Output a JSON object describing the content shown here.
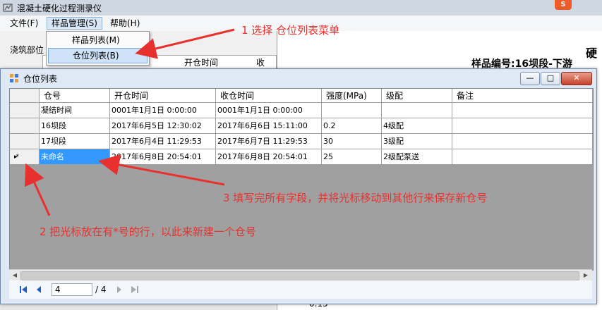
{
  "main_window": {
    "title": "混凝土硬化过程测录仪",
    "menu": [
      "文件(F)",
      "样品管理(S)",
      "帮助(H)"
    ],
    "dropdown": [
      "样品列表(M)",
      "仓位列表(B)"
    ],
    "bg_pour_label": "浇筑部位",
    "bg_col_open": "开仓时间",
    "bg_col_close": "收",
    "bg_hard": "硬",
    "bg_sample_no": "样品编号:16坝段-下游",
    "bg_axis_value": "0.15",
    "logo_letter": "S"
  },
  "dialog": {
    "title": "仓位列表",
    "columns": [
      "仓号",
      "开仓时间",
      "收仓时间",
      "强度(MPa)",
      "级配",
      "备注"
    ],
    "rows": [
      [
        "凝结时间",
        "0001年1月1日  0:00:00",
        "0001年1月1日  0:00:00",
        "",
        "",
        ""
      ],
      [
        "16坝段",
        "2017年6月5日  12:30:02",
        "2017年6月6日  15:11:00",
        "0.2",
        "4级配",
        ""
      ],
      [
        "17坝段",
        "2017年6月4日  11:29:53",
        "2017年6月7日  11:29:53",
        "30",
        "3级配",
        ""
      ],
      [
        "未命名",
        "2017年6月8日  20:54:01",
        "2017年6月8日  20:54:01",
        "25",
        "2级配泵送",
        ""
      ]
    ],
    "new_row_marker": "▸*",
    "nav": {
      "position": "4",
      "count": "/ 4"
    },
    "caption_buttons": {
      "min": "—",
      "max": "□",
      "close": "✕"
    }
  },
  "annotations": {
    "a1": "1 选择 仓位列表菜单",
    "a2": "2 把光标放在有*号的行，以此来新建一个仓号",
    "a3": "3 填写完所有字段，并将光标移动到其他行来保存新仓号"
  },
  "colors": {
    "annotation": "#e8312e",
    "selection": "#3399ff"
  }
}
